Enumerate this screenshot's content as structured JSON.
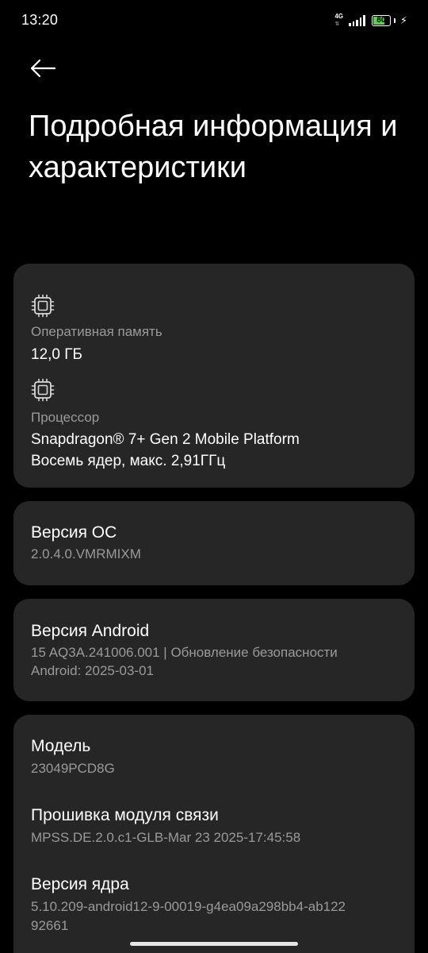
{
  "status_bar": {
    "time": "13:20",
    "network_type": "4G",
    "battery_level": "80",
    "battery_fraction": 0.8,
    "icons": [
      "signal-icon",
      "battery-icon",
      "charging-bolt-icon"
    ]
  },
  "header": {
    "back_icon": "back-arrow-icon",
    "title": "Подробная информация и характеристики"
  },
  "hardware": {
    "ram": {
      "icon": "chip-icon",
      "label": "Оперативная память",
      "value": "12,0 ГБ"
    },
    "cpu": {
      "icon": "chip-icon",
      "label": "Процессор",
      "value_line1": "Snapdragon® 7+ Gen 2 Mobile Platform",
      "value_line2": "Восемь ядер, макс. 2,91ГГц"
    }
  },
  "os_version": {
    "title": "Версия ОС",
    "value": "2.0.4.0.VMRMIXM"
  },
  "android_version": {
    "title": "Версия Android",
    "value_line1": "15 AQ3A.241006.001 | Обновление безопасности",
    "value_line2": "Android: 2025-03-01"
  },
  "model_info": {
    "model_title": "Модель",
    "model_value": "23049PCD8G",
    "baseband_title": "Прошивка модуля связи",
    "baseband_value": "MPSS.DE.2.0.c1-GLB-Mar 23 2025-17:45:58",
    "kernel_title": "Версия ядра",
    "kernel_value_line1": "5.10.209-android12-9-00019-g4ea09a298bb4-ab122",
    "kernel_value_line2": "92661"
  },
  "colors": {
    "background": "#000000",
    "card": "#262626",
    "muted_text": "#9a9a9a",
    "battery_fill": "#5bd14f"
  }
}
